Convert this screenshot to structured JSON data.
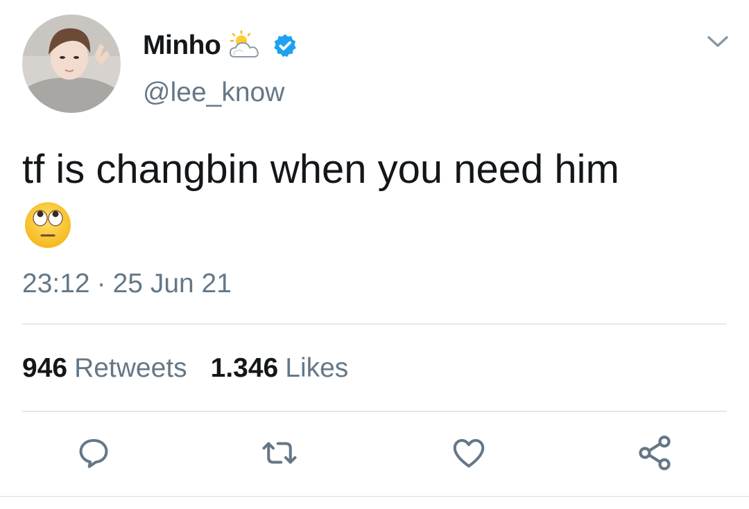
{
  "tweet": {
    "author": {
      "display_name": "Minho",
      "handle": "@lee_know",
      "name_emoji": "sun-behind-cloud-emoji",
      "verified_icon": "verified-badge-icon"
    },
    "text": "tf is changbin when you need him",
    "text_emoji": "face-with-rolling-eyes-emoji",
    "time": "23:12",
    "separator": "·",
    "date": "25 Jun 21",
    "stats": {
      "retweets_count": "946",
      "retweets_label": "Retweets",
      "likes_count": "1.346",
      "likes_label": "Likes"
    },
    "actions": [
      "reply-icon",
      "retweet-icon",
      "like-icon",
      "share-icon"
    ],
    "menu_icon": "chevron-down-icon"
  },
  "colors": {
    "text_primary": "#14171a",
    "text_secondary": "#657786",
    "verified_blue": "#1da1f2",
    "divider": "#e1e8ed"
  }
}
